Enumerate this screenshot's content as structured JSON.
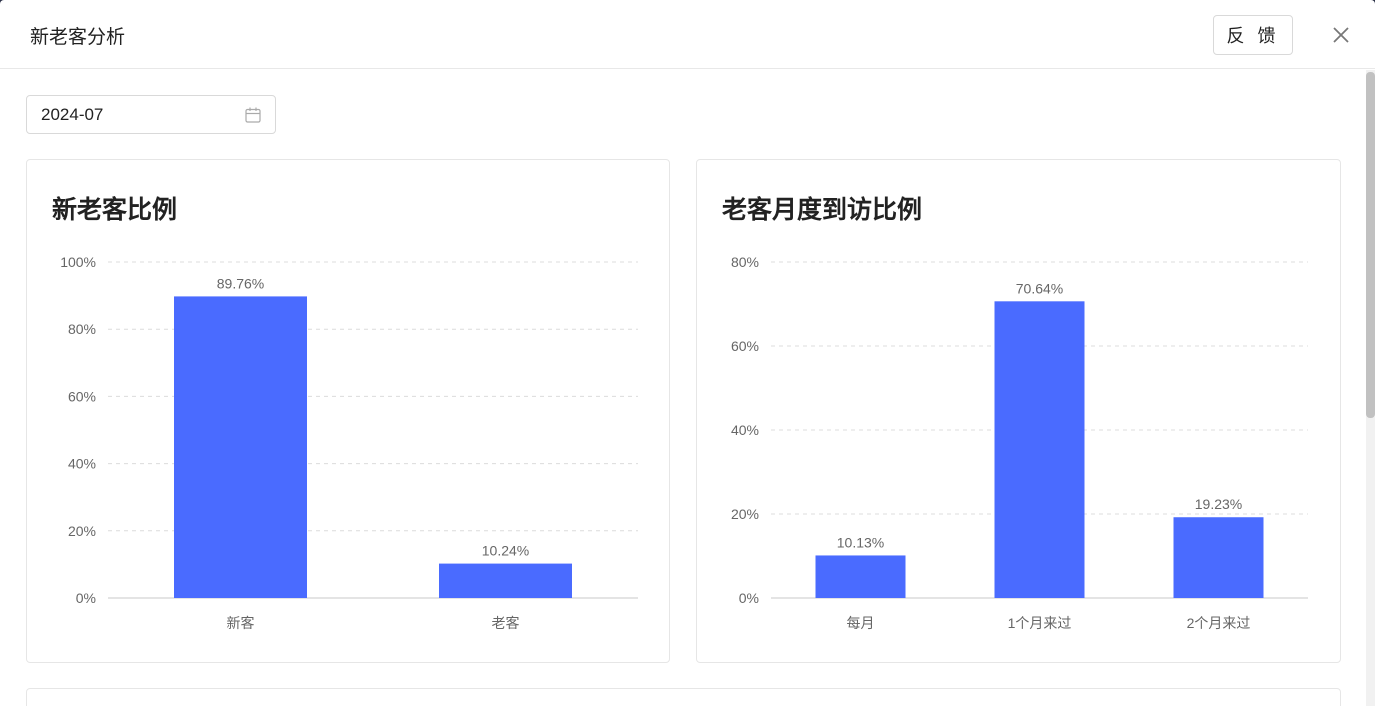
{
  "dialog": {
    "title": "新老客分析",
    "feedback_label": "反 馈"
  },
  "filters": {
    "month": "2024-07"
  },
  "cards": [
    {
      "title": "新老客比例"
    },
    {
      "title": "老客月度到访比例"
    }
  ],
  "colors": {
    "bar": "#4a6bff",
    "grid": "#dcdcdc",
    "axis_text": "#666666"
  },
  "chart_data": [
    {
      "type": "bar",
      "title": "新老客比例",
      "categories": [
        "新客",
        "老客"
      ],
      "values": [
        89.76,
        10.24
      ],
      "value_labels": [
        "89.76%",
        "10.24%"
      ],
      "ylim": [
        0,
        100
      ],
      "yticks": [
        "0%",
        "20%",
        "40%",
        "60%",
        "80%",
        "100%"
      ],
      "ytick_values": [
        0,
        20,
        40,
        60,
        80,
        100
      ],
      "grid": true
    },
    {
      "type": "bar",
      "title": "老客月度到访比例",
      "categories": [
        "每月",
        "1个月来过",
        "2个月来过"
      ],
      "values": [
        10.13,
        70.64,
        19.23
      ],
      "value_labels": [
        "10.13%",
        "70.64%",
        "19.23%"
      ],
      "ylim": [
        0,
        80
      ],
      "yticks": [
        "0%",
        "20%",
        "40%",
        "60%",
        "80%"
      ],
      "ytick_values": [
        0,
        20,
        40,
        60,
        80
      ],
      "grid": true
    }
  ]
}
